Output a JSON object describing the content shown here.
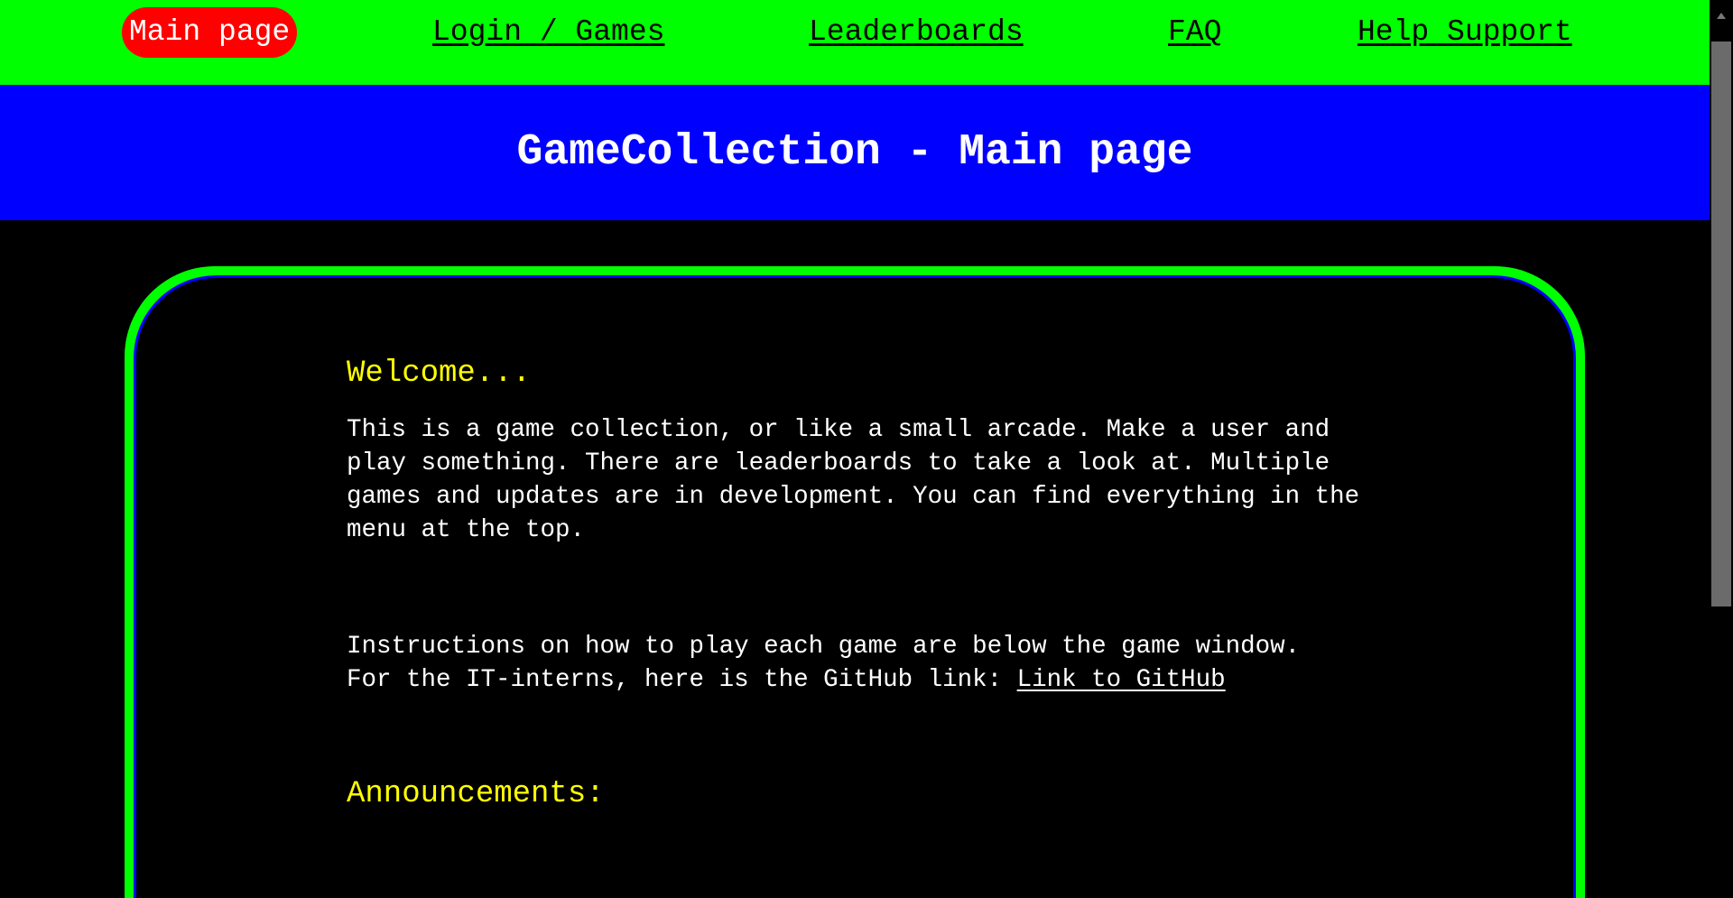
{
  "nav": {
    "items": [
      {
        "label": "Main page",
        "active": true
      },
      {
        "label": "Login / Games"
      },
      {
        "label": "Leaderboards"
      },
      {
        "label": "FAQ"
      },
      {
        "label": "Help Support"
      }
    ]
  },
  "header": {
    "title": "GameCollection - Main page"
  },
  "main": {
    "welcome_heading": "Welcome...",
    "intro": "This is a game collection, or like a small arcade. Make a user and play something. There are leaderboards to take a look at. Multiple games and updates are in development. You can find everything in the menu at the top.",
    "instructions": "Instructions on how to play each game are below the game window.",
    "github_text": "For the IT-interns, here is the GitHub link: ",
    "github_link": "Link to GitHub",
    "announcements_heading": "Announcements:"
  },
  "colors": {
    "nav_bg": "#00ff00",
    "header_bg": "#0000ff",
    "active": "#ff0000",
    "heading": "#ffff00"
  }
}
